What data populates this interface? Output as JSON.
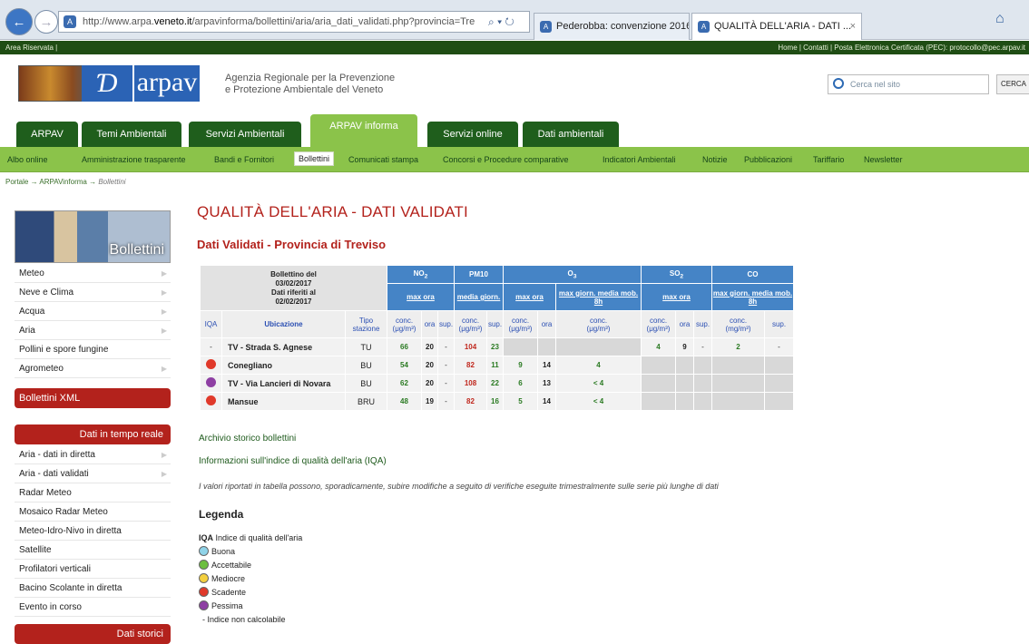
{
  "browser": {
    "url_pre": "http://www.arpa.",
    "url_domain": "veneto.it",
    "url_post": "/arpavinforma/bollettini/aria/aria_dati_validati.php?provincia=Tre",
    "tab1": "Pederobba: convenzione 2016-...",
    "tab2": "QUALITÀ DELL'ARIA - DATI ...",
    "tab2_close": "×"
  },
  "topbar": {
    "left": "Area Riservata  |",
    "right": "Home  |  Contatti  |  Posta Elettronica Certificata (PEC): protocollo@pec.arpav.it"
  },
  "header": {
    "logo": "arpav",
    "agency_line1": "Agenzia Regionale per la Prevenzione",
    "agency_line2": "e Protezione Ambientale del Veneto",
    "search_placeholder": "Cerca nel sito",
    "search_button": "CERCA"
  },
  "main_tabs": [
    "ARPAV",
    "Temi Ambientali",
    "Servizi Ambientali",
    "ARPAV informa",
    "Servizi online",
    "Dati ambientali"
  ],
  "sub_nav": [
    "Albo online",
    "Amministrazione trasparente",
    "Bandi e Fornitori",
    "Bollettini",
    "Comunicati stampa",
    "Concorsi e Procedure comparative",
    "Indicatori Ambientali",
    "Notizie",
    "Pubblicazioni",
    "Tariffario",
    "Newsletter"
  ],
  "breadcrumb": {
    "a": "Portale",
    "b": "ARPAVinforma",
    "c": "Bollettini",
    "sep": "→"
  },
  "sidebar": {
    "banner": "Bollettini",
    "items1": [
      "Meteo",
      "Neve e Clima",
      "Acqua",
      "Aria",
      "Pollini e spore fungine",
      "Agrometeo"
    ],
    "xml": "Bollettini XML",
    "realtime": "Dati in tempo reale",
    "items2": [
      "Aria - dati in diretta",
      "Aria - dati validati",
      "Radar Meteo",
      "Mosaico Radar Meteo",
      "Meteo-Idro-Nivo in diretta",
      "Satellite",
      "Profilatori verticali",
      "Bacino Scolante in diretta",
      "Evento in corso"
    ],
    "bottom": "Dati storici"
  },
  "content": {
    "title": "QUALITÀ DELL'ARIA - DATI VALIDATI",
    "subtitle": "Dati Validati - Provincia di Treviso",
    "bulletin_label": "Bollettino del",
    "bulletin_date": "03/02/2017",
    "ref_label": "Dati riferiti al",
    "ref_date": "02/02/2017",
    "pollutants": {
      "no2": "NO",
      "no2_sub": "2",
      "pm10": "PM10",
      "o3": "O",
      "o3_sub": "3",
      "so2": "SO",
      "so2_sub": "2",
      "co": "CO"
    },
    "metrics": {
      "no2": "max ora",
      "pm10": "media giorn.",
      "o3_a": "max ora",
      "o3_b": "max giorn. media mob. 8h",
      "so2": "max ora",
      "co": "max giorn. media mob. 8h"
    },
    "cols": {
      "iqa": "IQA",
      "ubicazione": "Ubicazione",
      "tipo": "Tipo stazione",
      "conc": "conc.",
      "ugm3": "(μg/m³)",
      "mgm3": "(mg/m³)",
      "ora": "ora",
      "sup": "sup."
    },
    "rows": [
      {
        "iqa": "-",
        "iqa_color": "",
        "name": "TV - Strada S. Agnese",
        "tipo": "TU",
        "no2": "66",
        "no2_ora": "20",
        "no2_sup": "-",
        "pm10": "104",
        "pm10_sup": "23",
        "o3": "",
        "o3_ora": "",
        "o3_8h": "",
        "so2": "4",
        "so2_ora": "9",
        "so2_sup": "-",
        "co": "2",
        "co_sup": "-"
      },
      {
        "iqa": "",
        "iqa_color": "#e0392a",
        "name": "Conegliano",
        "tipo": "BU",
        "no2": "54",
        "no2_ora": "20",
        "no2_sup": "-",
        "pm10": "82",
        "pm10_sup": "11",
        "o3": "9",
        "o3_ora": "14",
        "o3_8h": "4",
        "so2": "",
        "so2_ora": "",
        "so2_sup": "",
        "co": "",
        "co_sup": ""
      },
      {
        "iqa": "",
        "iqa_color": "#8e3fa3",
        "name": "TV - Via Lancieri di Novara",
        "tipo": "BU",
        "no2": "62",
        "no2_ora": "20",
        "no2_sup": "-",
        "pm10": "108",
        "pm10_sup": "22",
        "o3": "6",
        "o3_ora": "13",
        "o3_8h": "< 4",
        "so2": "",
        "so2_ora": "",
        "so2_sup": "",
        "co": "",
        "co_sup": ""
      },
      {
        "iqa": "",
        "iqa_color": "#e0392a",
        "name": "Mansue",
        "tipo": "BRU",
        "no2": "48",
        "no2_ora": "19",
        "no2_sup": "-",
        "pm10": "82",
        "pm10_sup": "16",
        "o3": "5",
        "o3_ora": "14",
        "o3_8h": "< 4",
        "so2": "",
        "so2_ora": "",
        "so2_sup": "",
        "co": "",
        "co_sup": ""
      }
    ],
    "link1": "Archivio storico bollettini",
    "link2": "Informazioni sull'indice di qualità dell'aria (IQA)",
    "note": "I valori riportati in tabella possono, sporadicamente, subire modifiche a seguito di verifiche eseguite trimestralmente sulle serie più lunghe di dati",
    "legend_title": "Legenda",
    "legend_iqa": "IQA",
    "legend_iqa_desc": "Indice di qualità dell'aria",
    "legend": [
      {
        "label": "Buona",
        "color": "#8fd3e8"
      },
      {
        "label": "Accettabile",
        "color": "#6cbf3f"
      },
      {
        "label": "Mediocre",
        "color": "#f4d03f"
      },
      {
        "label": "Scadente",
        "color": "#e0392a"
      },
      {
        "label": "Pessima",
        "color": "#8e3fa3"
      }
    ],
    "legend_nc": "-  Indice non calcolabile"
  }
}
